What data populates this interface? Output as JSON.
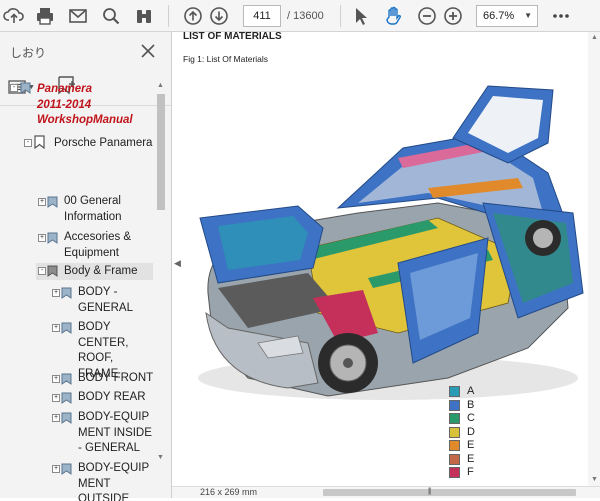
{
  "toolbar": {
    "page_current": "411",
    "page_total": "/ 13600",
    "zoom_value": "66.7%",
    "icons": [
      "upload-icon",
      "print-icon",
      "mail-icon",
      "search-icon",
      "binoculars-icon",
      "page-up-icon",
      "page-down-icon",
      "select-cursor-icon",
      "hand-tool-icon",
      "zoom-out-icon",
      "zoom-in-icon",
      "chevron-down-icon",
      "more-icon"
    ]
  },
  "sidebar": {
    "title": "しおり",
    "items": [
      {
        "label": "Panamera\n2011-2014\nWorkshopManual",
        "level": 0,
        "expanded": true
      },
      {
        "label": "Porsche Panamera",
        "level": 1,
        "expanded": true
      },
      {
        "label": "00 General\nInformation",
        "level": 2
      },
      {
        "label": "Accesories &\nEquipment",
        "level": 2
      },
      {
        "label": "Body & Frame",
        "level": 2,
        "selected": true
      },
      {
        "label": "BODY -\nGENERAL",
        "level": 3
      },
      {
        "label": "BODY\nCENTER,\nROOF, FRAME",
        "level": 3
      },
      {
        "label": "BODY FRONT",
        "level": 3
      },
      {
        "label": "BODY REAR",
        "level": 3
      },
      {
        "label": "BODY-EQUIP\nMENT INSIDE\n- GENERAL",
        "level": 3
      },
      {
        "label": "BODY-EQUIP\nMENT\nOUTSIDE",
        "level": 3
      }
    ]
  },
  "document": {
    "heading": "LIST OF MATERIALS",
    "caption": "Fig 1: List Of Materials",
    "page_size": "216 x 269 mm",
    "legend": [
      {
        "label": "A",
        "color": "#2a9bb5"
      },
      {
        "label": "B",
        "color": "#3d72c4"
      },
      {
        "label": "C",
        "color": "#2a9a6b"
      },
      {
        "label": "D",
        "color": "#d8c23a"
      },
      {
        "label": "E",
        "color": "#e08a2c"
      },
      {
        "label": "E",
        "color": "#c4684a"
      },
      {
        "label": "F",
        "color": "#c4305a"
      }
    ]
  }
}
